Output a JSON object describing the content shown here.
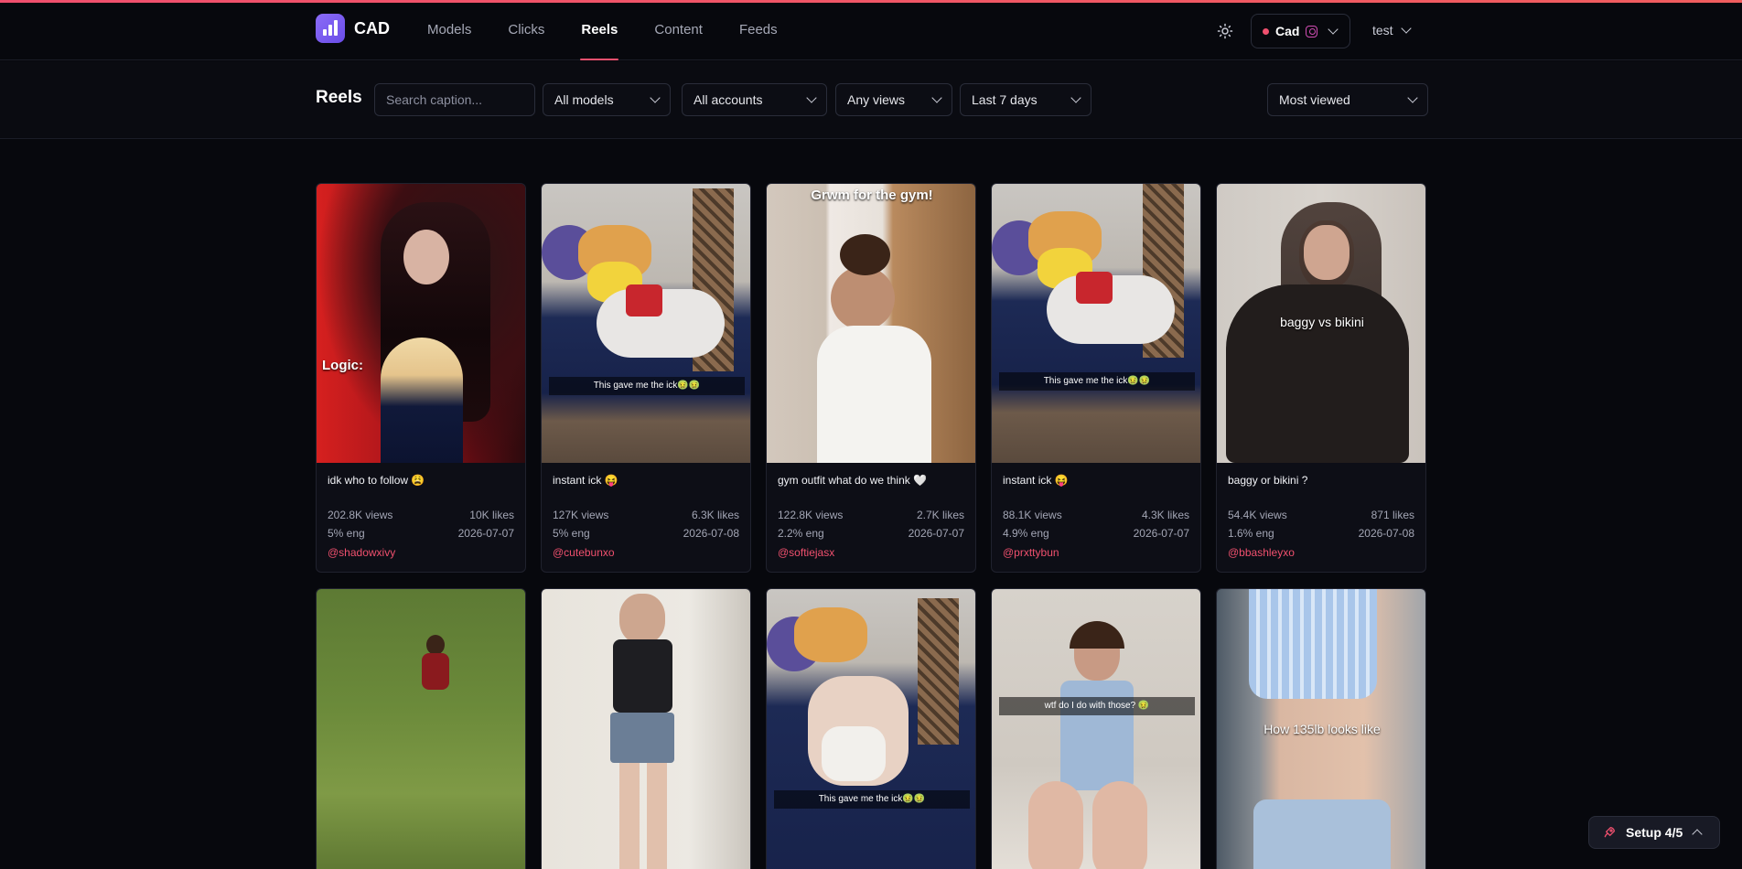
{
  "app": {
    "name": "CAD"
  },
  "nav": {
    "items": [
      {
        "label": "Models",
        "active": false
      },
      {
        "label": "Clicks",
        "active": false
      },
      {
        "label": "Reels",
        "active": true
      },
      {
        "label": "Content",
        "active": false
      },
      {
        "label": "Feeds",
        "active": false
      }
    ]
  },
  "header": {
    "account_label": "Cad",
    "user_label": "test",
    "accent": "#f0506e"
  },
  "toolbar": {
    "title": "Reels",
    "search_placeholder": "Search caption...",
    "filters": {
      "models": "All models",
      "accounts": "All accounts",
      "views": "Any views",
      "range": "Last 7 days",
      "sort": "Most viewed"
    }
  },
  "reels": [
    {
      "title": "idk who to follow 😩",
      "views": "202.8K views",
      "likes": "10K likes",
      "eng": "5% eng",
      "date": "2026-07-07",
      "handle": "@shadowxivy",
      "overlay": "Logic:"
    },
    {
      "title": "instant ick 😝",
      "views": "127K views",
      "likes": "6.3K likes",
      "eng": "5% eng",
      "date": "2026-07-08",
      "handle": "@cutebunxo",
      "overlay": "This gave me the ick🤢🤢"
    },
    {
      "title": "gym outfit what do we think 🤍",
      "views": "122.8K views",
      "likes": "2.7K likes",
      "eng": "2.2% eng",
      "date": "2026-07-07",
      "handle": "@softiejasx",
      "overlay": "Grwm for the gym!"
    },
    {
      "title": "instant ick 😝",
      "views": "88.1K views",
      "likes": "4.3K likes",
      "eng": "4.9% eng",
      "date": "2026-07-07",
      "handle": "@prxttybun",
      "overlay": "This gave me the ick🤢🤢"
    },
    {
      "title": "baggy or bikini ?",
      "views": "54.4K views",
      "likes": "871 likes",
      "eng": "1.6% eng",
      "date": "2026-07-08",
      "handle": "@bbashleyxo",
      "overlay": "baggy vs bikini"
    },
    {
      "overlay": ""
    },
    {
      "overlay": ""
    },
    {
      "overlay": "This gave me the ick🤢🤢"
    },
    {
      "overlay": "wtf do I do with those? 🤢"
    },
    {
      "overlay": "How 135lb looks like"
    }
  ],
  "setup": {
    "label": "Setup 4/5"
  }
}
